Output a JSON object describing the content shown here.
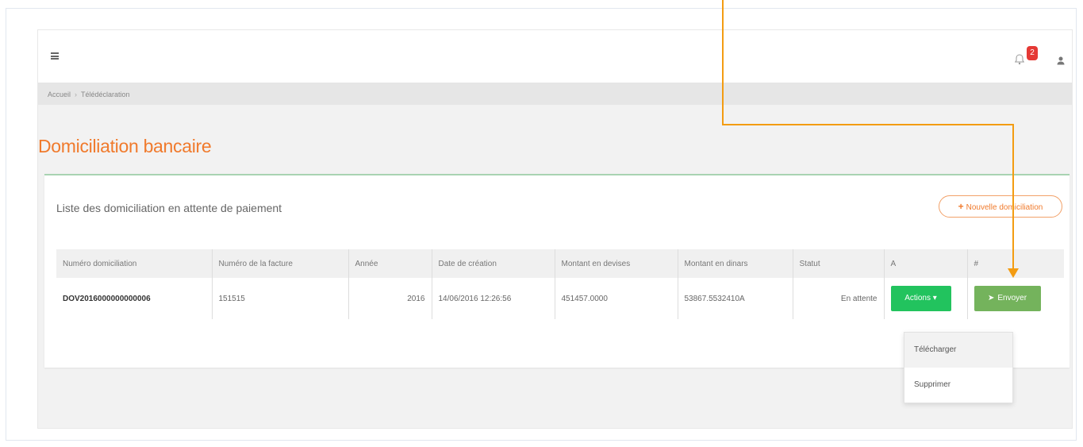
{
  "header": {
    "notification_count": "2"
  },
  "breadcrumb": {
    "items": [
      "Accueil",
      "Télédéclaration"
    ]
  },
  "page": {
    "title": "Domiciliation bancaire"
  },
  "panel": {
    "title": "Liste des domiciliation en attente de paiement",
    "new_button_label": "Nouvelle domiciliation"
  },
  "table": {
    "columns": [
      "Numéro domiciliation",
      "Numéro de la facture",
      "Année",
      "Date de création",
      "Montant en devises",
      "Montant en dinars",
      "Statut",
      "A",
      "#"
    ],
    "rows": [
      {
        "numero": "DOV2016000000000006",
        "facture": "151515",
        "annee": "2016",
        "date": "14/06/2016 12:26:56",
        "devises": "451457.0000",
        "dinars": "53867.5532410A",
        "statut": "En attente",
        "actions_label": "Actions ▾",
        "send_label": "Envoyer"
      }
    ]
  },
  "dropdown": {
    "items": [
      "Télécharger",
      "Supprimer"
    ]
  },
  "colors": {
    "accent_orange": "#f07a2c",
    "actions_green": "#22c35e",
    "send_green": "#74b35c",
    "badge_red": "#e53935",
    "arrow_orange": "#f39c12"
  },
  "icons": {
    "menu": "hamburger-icon",
    "bell": "bell-icon",
    "user": "user-icon",
    "send": "paper-plane-icon",
    "plus": "plus-icon"
  }
}
